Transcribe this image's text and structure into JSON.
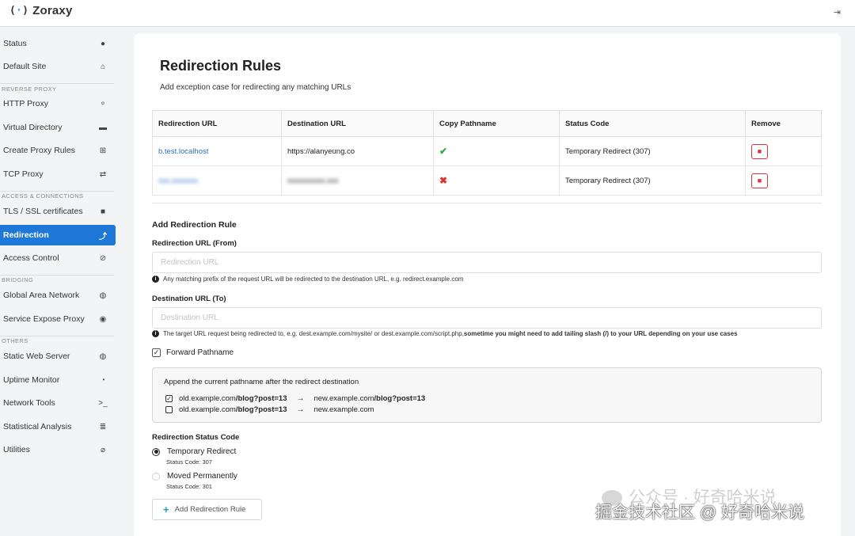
{
  "app": {
    "name": "Zoraxy",
    "logo_mark": "(·)"
  },
  "sidebar": {
    "items": [
      {
        "label": "Status",
        "icon": "info-circle-icon",
        "glyph": "●"
      },
      {
        "label": "Default Site",
        "icon": "home-icon",
        "glyph": "⌂"
      },
      {
        "label": "HTTP Proxy",
        "icon": "sitemap-icon",
        "glyph": "⚬"
      },
      {
        "label": "Virtual Directory",
        "icon": "folder-icon",
        "glyph": "▬"
      },
      {
        "label": "Create Proxy Rules",
        "icon": "plus-square-icon",
        "glyph": "⊞"
      },
      {
        "label": "TCP Proxy",
        "icon": "exchange-icon",
        "glyph": "⇄"
      },
      {
        "label": "TLS / SSL certificates",
        "icon": "lock-icon",
        "glyph": "■"
      },
      {
        "label": "Redirection",
        "icon": "level-up-icon",
        "glyph": "⤴"
      },
      {
        "label": "Access Control",
        "icon": "ban-icon",
        "glyph": "⊘"
      },
      {
        "label": "Global Area Network",
        "icon": "globe-icon",
        "glyph": "◍"
      },
      {
        "label": "Service Expose Proxy",
        "icon": "podcast-icon",
        "glyph": "◉"
      },
      {
        "label": "Static Web Server",
        "icon": "globe-icon",
        "glyph": "◍"
      },
      {
        "label": "Uptime Monitor",
        "icon": "clock-icon",
        "glyph": "◔"
      },
      {
        "label": "Network Tools",
        "icon": "terminal-icon",
        "glyph": ">_"
      },
      {
        "label": "Statistical Analysis",
        "icon": "database-icon",
        "glyph": "≣"
      },
      {
        "label": "Utilities",
        "icon": "paperclip-icon",
        "glyph": "⌀"
      }
    ],
    "headers": [
      "REVERSE PROXY",
      "ACCESS & CONNECTIONS",
      "BRIDGING",
      "OTHERS"
    ],
    "active": "Redirection"
  },
  "main": {
    "title": "Redirection Rules",
    "subtitle": "Add exception case for redirecting any matching URLs",
    "table": {
      "headers": [
        "Redirection URL",
        "Destination URL",
        "Copy Pathname",
        "Status Code",
        "Remove"
      ],
      "rows": [
        {
          "from": "b.test.localhost",
          "to": "https://alanyeung.co",
          "copy": true,
          "status": "Temporary Redirect (307)",
          "blurred": false
        },
        {
          "from": "xxx.xxxxxxx",
          "to": "xxxxxxxxxx.xxx",
          "copy": false,
          "status": "Temporary Redirect (307)",
          "blurred": true
        }
      ]
    },
    "form": {
      "title": "Add Redirection Rule",
      "from_label": "Redirection URL (From)",
      "from_placeholder": "Redirection URL",
      "from_hint": "Any matching prefix of the request URL will be redirected to the destination URL, e.g. redirect.example.com",
      "to_label": "Destination URL (To)",
      "to_placeholder": "Destination URL",
      "to_hint_plain": "The target URL request being redirected to, e.g. dest.example.com/mysite/ or dest.example.com/script.php, ",
      "to_hint_bold": "sometime you might need to add tailing slash (/) to your URL depending on your use cases",
      "forward_label": "Forward Pathname",
      "forward_checked": true,
      "info_title": "Append the current pathname after the redirect destination",
      "examples": [
        {
          "checked": true,
          "from_host": "old.example.com",
          "from_path": "/blog?post=13",
          "arrow": "→",
          "to_host": "new.example.com",
          "to_path": "/blog?post=13"
        },
        {
          "checked": false,
          "from_host": "old.example.com",
          "from_path": "/blog?post=13",
          "arrow": "→",
          "to_host": "new.example.com",
          "to_path": ""
        }
      ],
      "status_label": "Redirection Status Code",
      "status_options": [
        {
          "label": "Temporary Redirect",
          "sub": "Status Code: 307",
          "selected": true
        },
        {
          "label": "Moved Permanently",
          "sub": "Status Code: 301",
          "selected": false
        }
      ],
      "add_button": "Add Redirection Rule"
    }
  },
  "watermark": {
    "line1": "公众号 · 好奇哈米说",
    "line2": "掘金技术社区 @ 好奇哈米说"
  },
  "colors": {
    "accent": "#1e78d7",
    "link": "#2f6fc8",
    "danger": "#d33333",
    "success": "#2fa84f"
  }
}
